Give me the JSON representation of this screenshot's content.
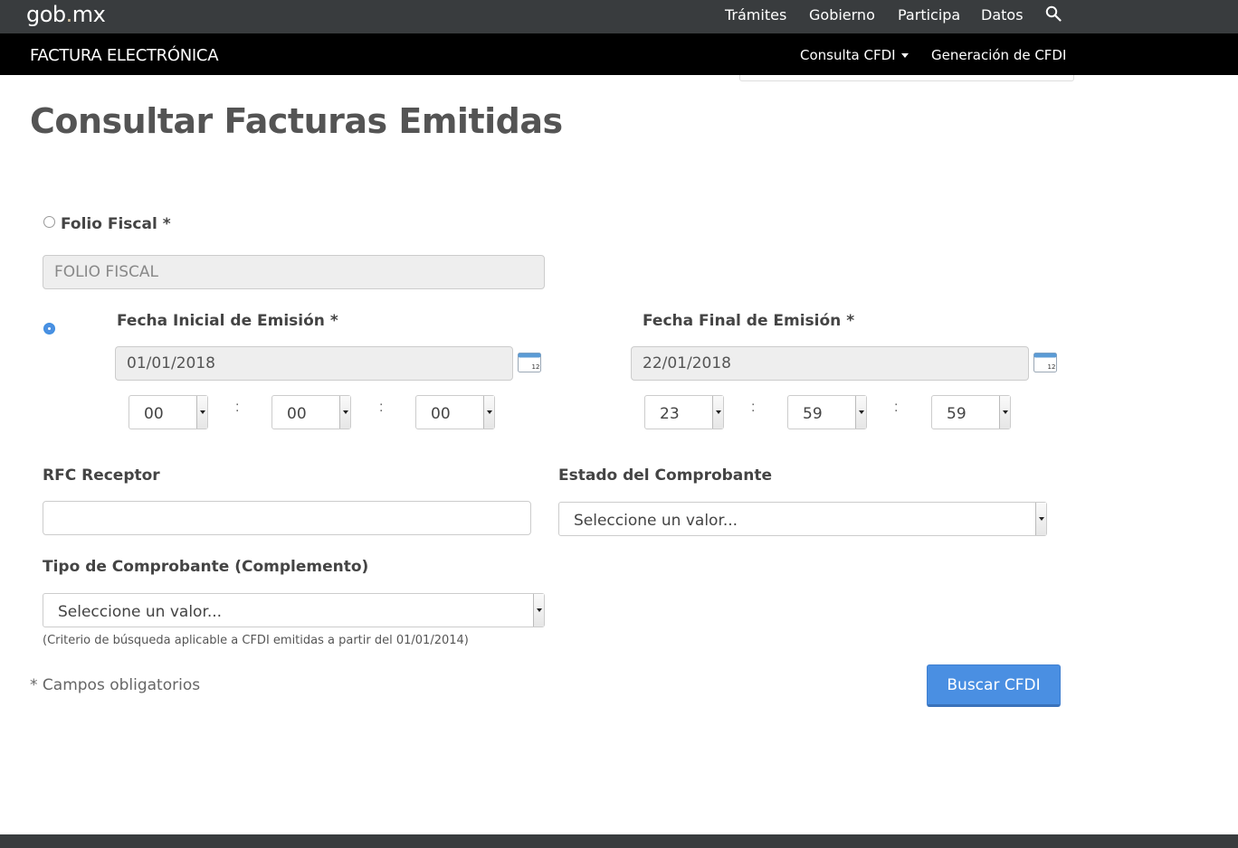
{
  "topbar": {
    "logo_main": "gob",
    "logo_dot": ".",
    "logo_tail": "mx",
    "nav": [
      "Trámites",
      "Gobierno",
      "Participa",
      "Datos"
    ],
    "search_icon": "search-icon"
  },
  "subbar": {
    "title": "FACTURA ELECTRÓNICA",
    "consulta": "Consulta CFDI",
    "generacion": "Generación de CFDI"
  },
  "page": {
    "title": "Consultar Facturas Emitidas"
  },
  "form": {
    "folio_label": "Folio Fiscal *",
    "folio_placeholder": "FOLIO FISCAL",
    "fecha_inicial_label": "Fecha Inicial de Emisión *",
    "fecha_inicial_value": "01/01/2018",
    "fecha_final_label": "Fecha Final de Emisión *",
    "fecha_final_value": "22/01/2018",
    "hora_inicial": [
      "00",
      "00",
      "00"
    ],
    "hora_final": [
      "23",
      "59",
      "59"
    ],
    "time_separator": ":",
    "rfc_label": "RFC Receptor",
    "rfc_value": "",
    "estado_label": "Estado del Comprobante",
    "estado_value": "Seleccione un valor...",
    "tipo_label": "Tipo de Comprobante (Complemento)",
    "tipo_value": "Seleccione un valor...",
    "tipo_hint": "(Criterio de búsqueda aplicable a CFDI emitidas a partir del 01/01/2014)",
    "required_note": "* Campos obligatorios",
    "submit_label": "Buscar CFDI",
    "selected_mode": "fecha"
  },
  "colors": {
    "topbar": "#393c3e",
    "subbar": "#000000",
    "accent": "#4a8fe2",
    "logo_dot": "#d4c19c"
  }
}
